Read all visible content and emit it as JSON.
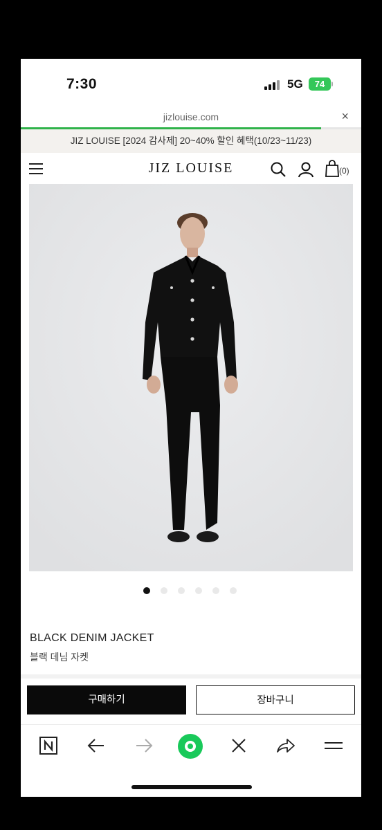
{
  "status_bar": {
    "time": "7:30",
    "network": "5G",
    "battery": "74"
  },
  "browser": {
    "url": "jizlouise.com",
    "close_label": "×"
  },
  "promo_banner": {
    "text": "JIZ LOUISE [2024 감사제] 20~40% 할인 혜택(10/23~11/23)"
  },
  "site_header": {
    "logo": "JIZ LOUISE",
    "cart_count": "(0)",
    "icons": [
      "menu-icon",
      "search-icon",
      "user-icon",
      "cart-icon"
    ]
  },
  "gallery": {
    "image_count": 6,
    "active_index": 0
  },
  "product": {
    "name": "BLACK DENIM JACKET",
    "name_ko": "블랙 데님 자켓"
  },
  "actions": {
    "buy_label": "구매하기",
    "cart_label": "장바구니"
  },
  "browser_toolbar": {
    "icons": [
      "naver-n-icon",
      "back-arrow-icon",
      "forward-arrow-icon",
      "naver-green-circle-icon",
      "close-x-icon",
      "share-icon",
      "menu-lines-icon"
    ]
  },
  "colors": {
    "accent_green": "#2fb34a",
    "battery_green": "#34c759",
    "button_black": "#0a0a0a",
    "promo_bg": "#f3f1ee"
  }
}
